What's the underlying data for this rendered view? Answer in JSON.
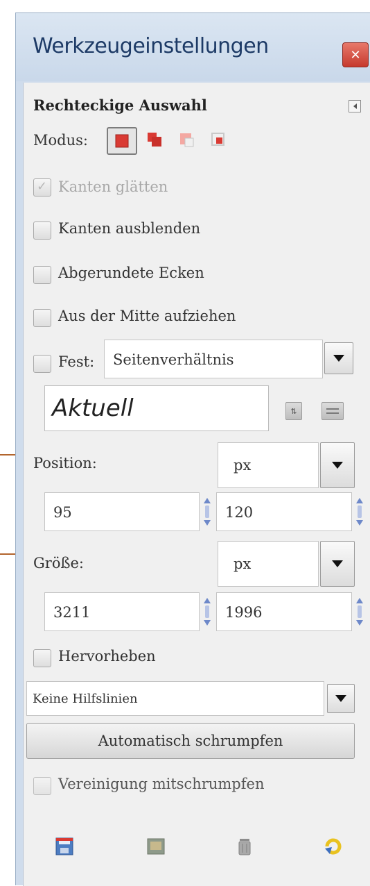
{
  "dialog": {
    "title": "Werkzeugeinstellungen"
  },
  "tool": {
    "name": "Rechteckige Auswahl",
    "mode_label": "Modus:",
    "mode_icons": [
      "replace-selection-icon",
      "add-selection-icon",
      "subtract-selection-icon",
      "intersect-selection-icon"
    ],
    "options": {
      "antialias": {
        "label": "Kanten glätten",
        "checked": true,
        "disabled": true
      },
      "feather": {
        "label": "Kanten ausblenden",
        "checked": false
      },
      "rounded": {
        "label": "Abgerundete Ecken",
        "checked": false
      },
      "expand_center": {
        "label": "Aus der Mitte aufziehen",
        "checked": false
      }
    },
    "fixed": {
      "label": "Fest:",
      "select_value": "Seitenverhältnis",
      "value": "Aktuell"
    },
    "position": {
      "label": "Position:",
      "unit": "px",
      "x": "95",
      "y": "120"
    },
    "size": {
      "label": "Größe:",
      "unit": "px",
      "w": "3211",
      "h": "1996"
    },
    "highlight": {
      "label": "Hervorheben",
      "checked": false
    },
    "guides": {
      "select_value": "Keine Hilfslinien"
    },
    "autoshrink_button": "Automatisch schrumpfen",
    "shrink_merged": {
      "label": "Vereinigung mitschrumpfen",
      "checked": false,
      "disabled": true
    }
  },
  "bottom_toolbar": {
    "icons": [
      "save-options-icon",
      "restore-options-icon",
      "delete-options-icon",
      "reset-options-icon"
    ]
  },
  "colors": {
    "accent": "#d93a33",
    "callout": "#b2652d",
    "titlebar": "#cfdcec"
  }
}
